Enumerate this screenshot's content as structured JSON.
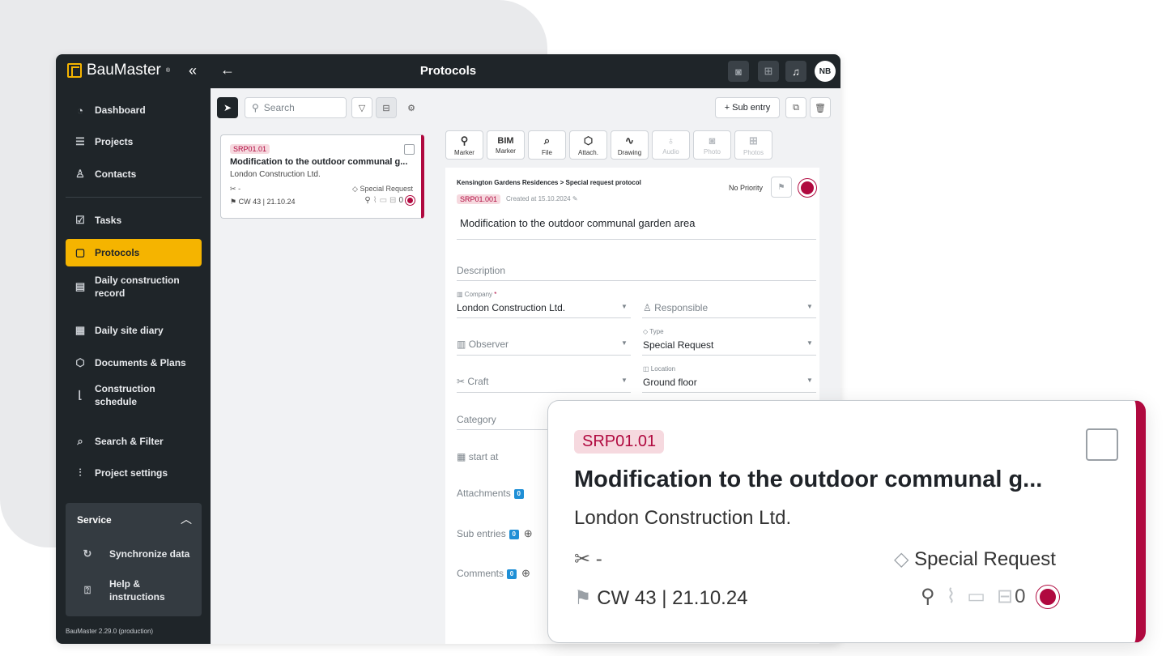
{
  "app": {
    "brand": "BauMaster",
    "brand_mark": "®",
    "collapse_glyph": "«",
    "back_glyph": "←",
    "title": "Protocols",
    "avatar": "NB",
    "version": "BauMaster 2.29.0 (production)"
  },
  "sidebar": {
    "items": [
      {
        "label": "Dashboard",
        "icon": "gauge-icon"
      },
      {
        "label": "Projects",
        "icon": "list-icon"
      },
      {
        "label": "Contacts",
        "icon": "person-icon"
      },
      {
        "label": "Tasks",
        "icon": "clipboard-check-icon"
      },
      {
        "label": "Protocols",
        "icon": "clipboard-icon"
      },
      {
        "label": "Daily construction record",
        "icon": "document-icon"
      },
      {
        "label": "Daily site diary",
        "icon": "building-icon"
      },
      {
        "label": "Documents & Plans",
        "icon": "cube-icon"
      },
      {
        "label": "Construction schedule",
        "icon": "chart-icon"
      },
      {
        "label": "Search & Filter",
        "icon": "search-doc-icon"
      },
      {
        "label": "Project settings",
        "icon": "sliders-icon"
      }
    ],
    "service": {
      "title": "Service",
      "items": [
        {
          "label": "Synchronize data",
          "icon": "sync-icon"
        },
        {
          "label": "Help & instructions",
          "icon": "help-icon"
        }
      ]
    }
  },
  "toolbar": {
    "search_placeholder": "Search",
    "sub_entry": "+ Sub entry"
  },
  "card": {
    "code": "SRP01.01",
    "title": "Modification to the outdoor communal g...",
    "company": "London Construction Ltd.",
    "craft": "-",
    "type": "Special Request",
    "cw": "CW 43 | 21.10.24",
    "count": "0"
  },
  "attach_bar": [
    {
      "glyph": "⚲",
      "label": "Marker",
      "enabled": true
    },
    {
      "glyph": "BIM",
      "label": "Marker",
      "enabled": true
    },
    {
      "glyph": "⌕",
      "label": "File",
      "enabled": true
    },
    {
      "glyph": "⬡",
      "label": "Attach.",
      "enabled": true
    },
    {
      "glyph": "∿",
      "label": "Drawing",
      "enabled": true
    },
    {
      "glyph": "♁",
      "label": "Audio",
      "enabled": false
    },
    {
      "glyph": "◙",
      "label": "Photo",
      "enabled": false
    },
    {
      "glyph": "⊞",
      "label": "Photos",
      "enabled": false
    }
  ],
  "form": {
    "breadcrumb": "Kensington Gardens Residences > Special request protocol",
    "priority": "No Priority",
    "code": "SRP01.001",
    "created": "Created at 15.10.2024",
    "title": "Modification to the outdoor communal garden area",
    "description_label": "Description",
    "company_caption": "Company",
    "company_required": "*",
    "company_value": "London Construction Ltd.",
    "responsible_label": "Responsible",
    "observer_label": "Observer",
    "type_caption": "Type",
    "type_value": "Special Request",
    "craft_label": "Craft",
    "location_caption": "Location",
    "location_value": "Ground floor",
    "category_label": "Category",
    "start_label": "start at",
    "attachments_label": "Attachments",
    "attachments_count": "0",
    "sub_entries_label": "Sub entries",
    "sub_entries_count": "0",
    "comments_label": "Comments",
    "comments_count": "0"
  },
  "colors": {
    "accent": "#f5b400",
    "status": "#b0093f",
    "sidebar_bg": "#1f2529"
  }
}
